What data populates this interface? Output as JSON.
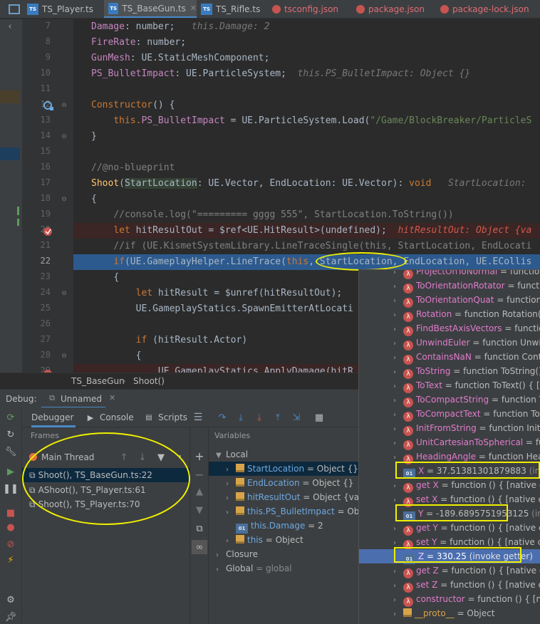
{
  "tabs": [
    {
      "label": "TS_Player.ts",
      "type": "ts",
      "active": false
    },
    {
      "label": "TS_BaseGun.ts",
      "type": "ts",
      "active": true
    },
    {
      "label": "TS_Rifle.ts",
      "type": "ts",
      "active": false
    },
    {
      "label": "tsconfig.json",
      "type": "json",
      "active": false
    },
    {
      "label": "package.json",
      "type": "json",
      "active": false
    },
    {
      "label": "package-lock.json",
      "type": "json",
      "active": false
    }
  ],
  "code": {
    "line_numbers": [
      "7",
      "8",
      "9",
      "10",
      "11",
      "12",
      "13",
      "14",
      "15",
      "16",
      "17",
      "18",
      "19",
      "20",
      "21",
      "22",
      "23",
      "24",
      "25",
      "26",
      "27",
      "28",
      "29"
    ],
    "l7_name": "Damage",
    "l7_rest": ": number;",
    "l7_hint": "this.Damage: 2",
    "l8_name": "FireRate",
    "l8_rest": ": number;",
    "l9_name": "GunMesh",
    "l9_rest": ": UE.StaticMeshComponent;",
    "l10_name": "PS_BulletImpact",
    "l10_rest": ": UE.ParticleSystem;",
    "l10_hint": "this.PS_BulletImpact: Object {}",
    "l12_kw": "Constructor",
    "l12_rest": "() {",
    "l13_this": "this.",
    "l13_prop": "PS_BulletImpact",
    "l13_rest": " = UE.ParticleSystem.Load(",
    "l13_str": "\"/Game/BlockBreaker/ParticleS",
    "l14": "}",
    "l16": "//@no-blueprint",
    "l17_fn": "Shoot",
    "l17_p1": "StartLocation",
    "l17_mid": ": UE.Vector, ",
    "l17_p2": "EndLocation",
    "l17_rest": ": UE.Vector): ",
    "l17_void": "void",
    "l17_hint": "StartLocation: ",
    "l18": "{",
    "l19": "//console.log(\"========= gggg 555\", StartLocation.ToString())",
    "l20_let": "let",
    "l20_rest": " hitResultOut = $ref<UE.HitResult>(undefined);",
    "l20_hint": "hitResultOut: Object {va",
    "l21": "//if (UE.KismetSystemLibrary.LineTraceSingle(this, StartLocation, EndLocati",
    "l22_if": "if",
    "l22_a": "(UE.GameplayHelper.LineTrace(",
    "l22_this": "this",
    "l22_b": ", ",
    "l22_p1": "StartLocation",
    "l22_c": ", ",
    "l22_p2": "EndLocation",
    "l22_d": ", UE.ECollis",
    "l23": "{",
    "l24_let": "let",
    "l24_rest": " hitResult = $unref(hitResultOut);",
    "l25": "UE.GameplayStatics.SpawnEmitterAtLocati",
    "l27_if": "if",
    "l27_rest": " (hitResult.Actor)",
    "l28": "{",
    "l29": "UE.GameplayStatics.ApplyDamage(hitR"
  },
  "breadcrumb": {
    "class": "TS_BaseGun",
    "method": "Shoot()"
  },
  "debug": {
    "label": "Debug:",
    "session": "Unnamed",
    "tabs": {
      "debugger": "Debugger",
      "console": "Console",
      "scripts": "Scripts"
    },
    "frames_header": "Frames",
    "variables_header": "Variables",
    "thread": "Main Thread",
    "frames": [
      "Shoot(), TS_BaseGun.ts:22",
      "AShoot(), TS_Player.ts:61",
      "Shoot(), TS_Player.ts:70"
    ],
    "vars": {
      "local": "Local",
      "items": [
        {
          "name": "StartLocation",
          "value": " = Object {}"
        },
        {
          "name": "EndLocation",
          "value": " = Object {}"
        },
        {
          "name": "hitResultOut",
          "value": " = Object {value"
        },
        {
          "name": "this.PS_BulletImpact",
          "value": " = Object"
        },
        {
          "name": "this.Damage",
          "value": " = 2"
        },
        {
          "name": "this",
          "value": " = Object"
        }
      ],
      "closure": "Closure",
      "global_name": "Global",
      "global_value": " = global"
    }
  },
  "popup": {
    "items": [
      {
        "kind": "fn",
        "name": "ProjectOnToNormal",
        "value": " = function P"
      },
      {
        "kind": "fn",
        "name": "ToOrientationRotator",
        "value": " = function"
      },
      {
        "kind": "fn",
        "name": "ToOrientationQuat",
        "value": " = function To"
      },
      {
        "kind": "fn",
        "name": "Rotation",
        "value": " = function Rotation() { ["
      },
      {
        "kind": "fn",
        "name": "FindBestAxisVectors",
        "value": " = function F"
      },
      {
        "kind": "fn",
        "name": "UnwindEuler",
        "value": " = function UnwindE"
      },
      {
        "kind": "fn",
        "name": "ContainsNaN",
        "value": " = function Contain"
      },
      {
        "kind": "fn",
        "name": "ToString",
        "value": " = function ToString() { [n"
      },
      {
        "kind": "fn",
        "name": "ToText",
        "value": " = function ToText() { [nati"
      },
      {
        "kind": "fn",
        "name": "ToCompactString",
        "value": " = function ToC"
      },
      {
        "kind": "fn",
        "name": "ToCompactText",
        "value": " = function ToCo"
      },
      {
        "kind": "fn",
        "name": "InitFromString",
        "value": " = function InitFrom"
      },
      {
        "kind": "fn",
        "name": "UnitCartesianToSpherical",
        "value": " = funct"
      },
      {
        "kind": "fn",
        "name": "HeadingAngle",
        "value": " = function Headin"
      },
      {
        "kind": "val",
        "name": "X",
        "value": " = 37.51381301879883",
        "extra": " (invoke g"
      },
      {
        "kind": "fn",
        "name": "get X",
        "value": " = function () { [native code]"
      },
      {
        "kind": "fn",
        "name": "set X",
        "value": " = function () { [native code]"
      },
      {
        "kind": "val",
        "name": "Y",
        "value": " = -189.6895751953125",
        "extra": " (invoke g"
      },
      {
        "kind": "fn",
        "name": "get Y",
        "value": " = function () { [native code]"
      },
      {
        "kind": "fn",
        "name": "set Y",
        "value": " = function () { [native code]"
      },
      {
        "kind": "val",
        "name": "Z",
        "value": " = 330.25",
        "extra": " (invoke getter)"
      },
      {
        "kind": "fn",
        "name": "get Z",
        "value": " = function () { [native code]"
      },
      {
        "kind": "fn",
        "name": "set Z",
        "value": " = function () { [native code]"
      },
      {
        "kind": "fn",
        "name": "constructor",
        "value": " = function () { [native"
      },
      {
        "kind": "proto",
        "name": "__proto__",
        "value": " = Object"
      }
    ]
  },
  "colors": {
    "highlight": "#f0f000",
    "exec_line": "#2d5a8e",
    "selection": "#4b6eaf"
  }
}
